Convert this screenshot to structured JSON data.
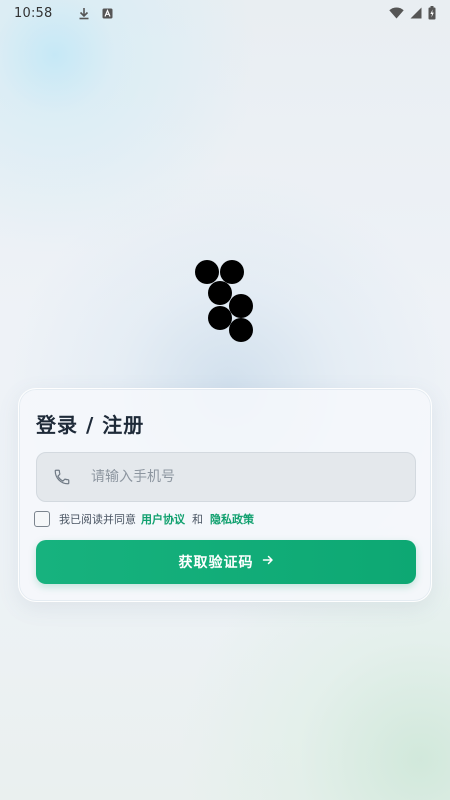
{
  "status_bar": {
    "time": "10:58",
    "left_icons": [
      "download-icon",
      "app-a-icon"
    ],
    "right_icons": [
      "wifi-icon",
      "cellular-signal-icon",
      "battery-charging-icon"
    ]
  },
  "logo": {
    "icon": "black-dot-cluster-logo",
    "color": "#000000"
  },
  "login": {
    "title": "登录 / 注册",
    "phone_placeholder": "请输入手机号",
    "phone_value": "",
    "phone_icon": "phone-icon",
    "agree_prefix": "我已阅读并同意",
    "user_agreement": "用户协议",
    "and_text": "和",
    "privacy_policy": "隐私政策",
    "agree_checked": false,
    "submit_label": "获取验证码",
    "submit_icon": "arrow-right-icon"
  },
  "colors": {
    "accent": "#10a06e",
    "title": "#1e2a38",
    "button_text": "#ffffff"
  }
}
